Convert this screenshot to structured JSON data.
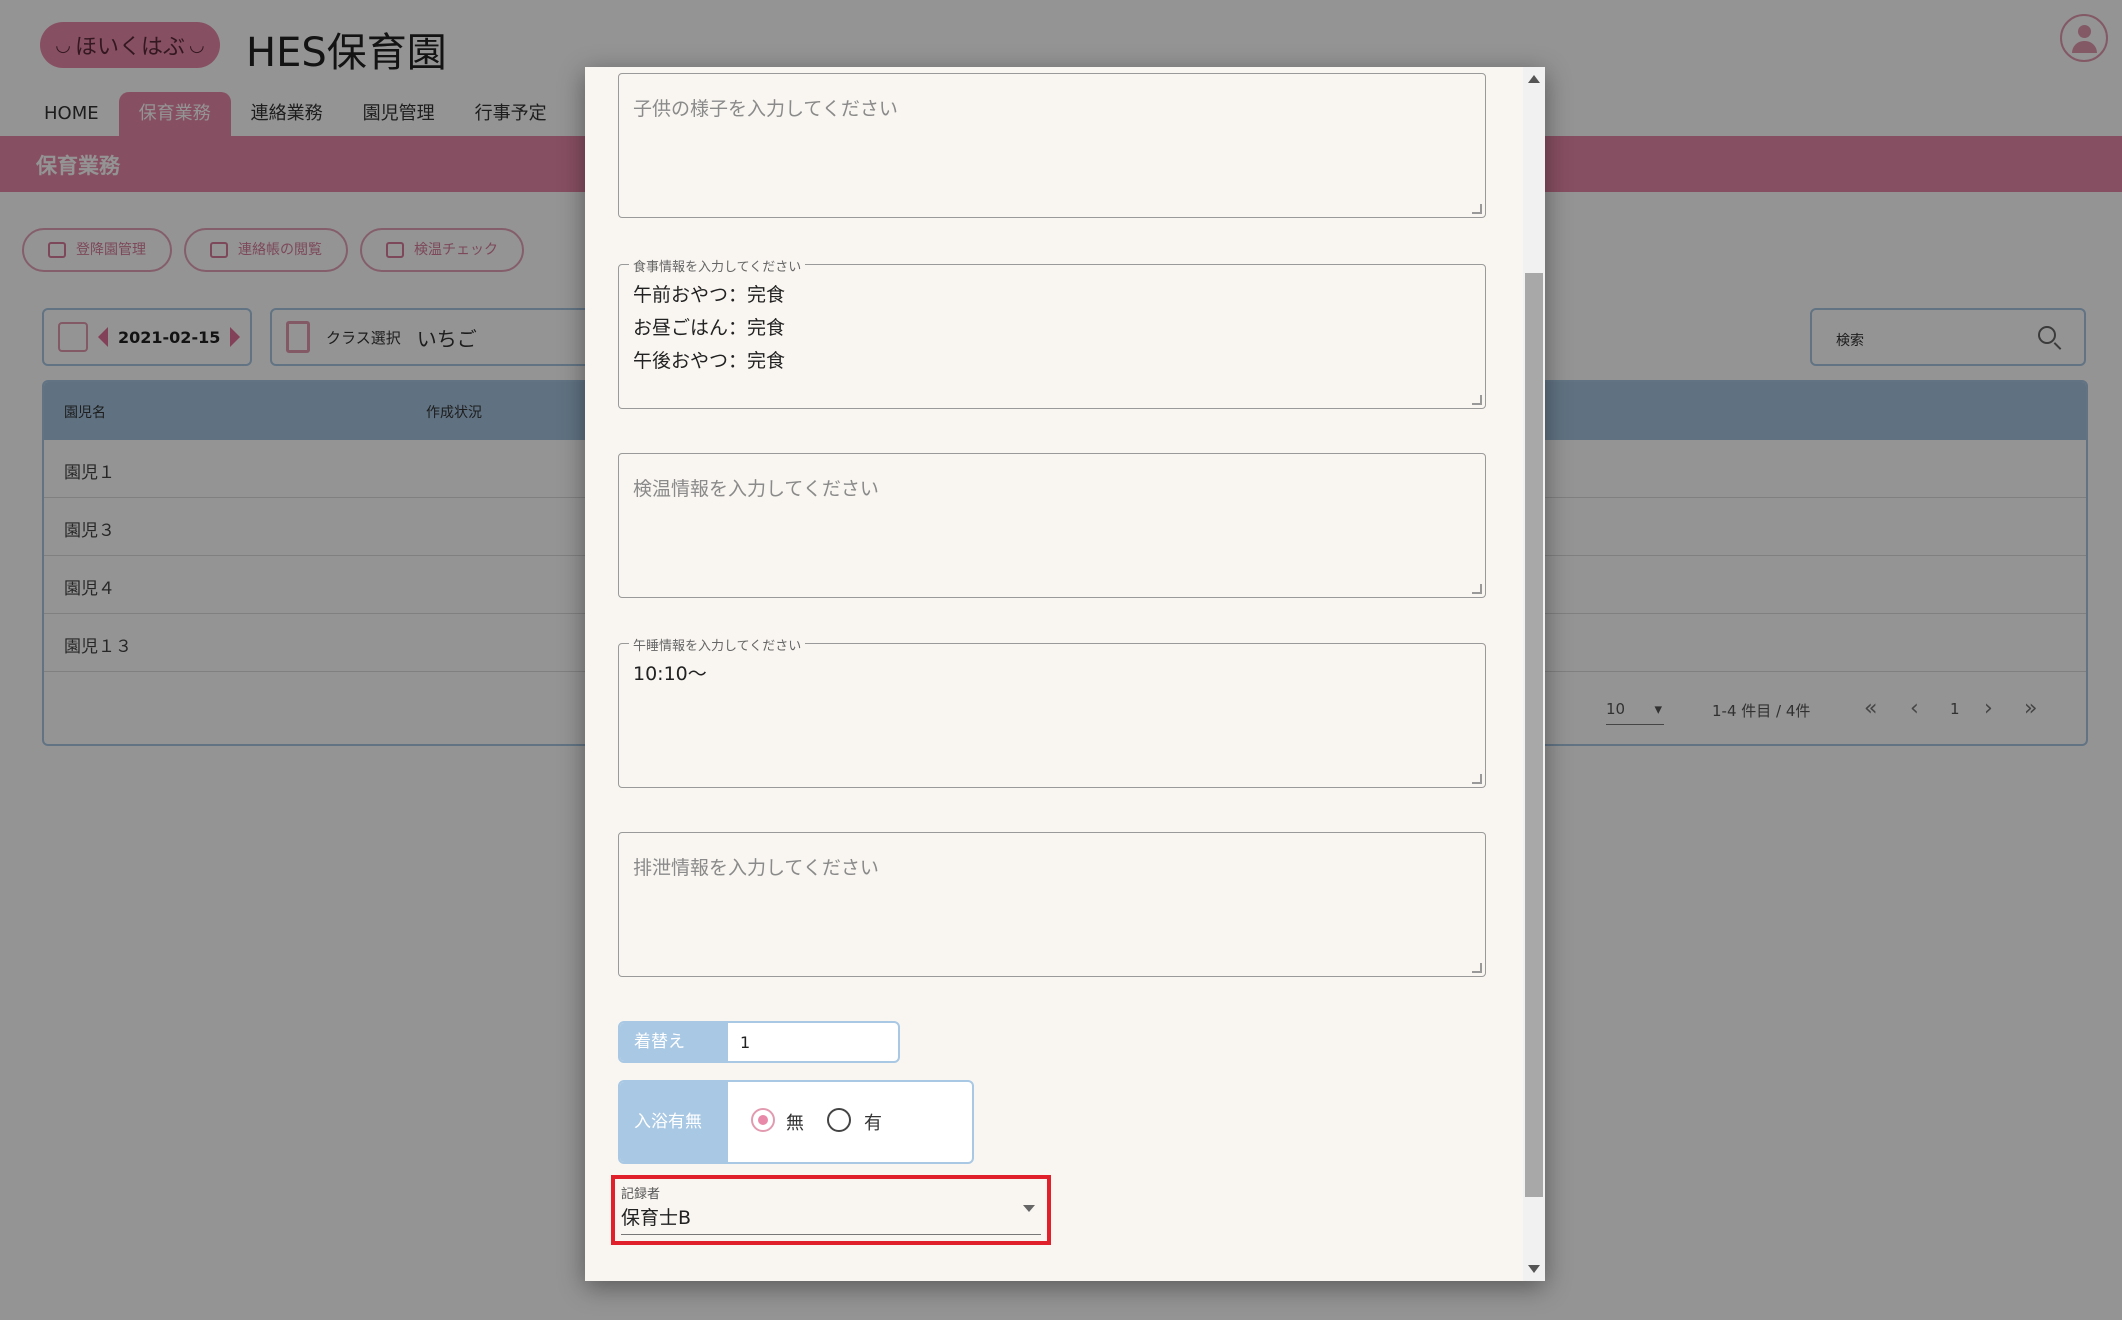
{
  "header": {
    "logo_text": "ほいくはぶ",
    "site_title": "HES保育園"
  },
  "nav": {
    "items": [
      "HOME",
      "保育業務",
      "連絡業務",
      "園児管理",
      "行事予定"
    ]
  },
  "section": {
    "title": "保育業務"
  },
  "tools": {
    "items": [
      "登降園管理",
      "連絡帳の閲覧",
      "検温チェック"
    ]
  },
  "filters": {
    "date": "2021-02-15",
    "class_label": "クラス選択",
    "class_value": "いちご",
    "search_label": "検索"
  },
  "table": {
    "headers": [
      "園児名",
      "作成状況"
    ],
    "rows": [
      "園児１",
      "園児３",
      "園児４",
      "園児１３"
    ],
    "pager": {
      "per_page": "10",
      "range": "1-4 件目 / 4件",
      "page": "1"
    }
  },
  "modal": {
    "child_state_placeholder": "子供の様子を入力してください",
    "meal": {
      "legend": "食事情報を入力してください",
      "value": "午前おやつ：完食\nお昼ごはん：完食\n午後おやつ：完食"
    },
    "temperature_placeholder": "検温情報を入力してください",
    "nap": {
      "legend": "午睡情報を入力してください",
      "value": "10:10～"
    },
    "excretion_placeholder": "排泄情報を入力してください",
    "change": {
      "label": "着替え",
      "value": "1"
    },
    "bath": {
      "label": "入浴有無",
      "options": [
        "無",
        "有"
      ],
      "selected": "無"
    },
    "recorder": {
      "label": "記録者",
      "value": "保育士B"
    }
  },
  "colors": {
    "brand_pink": "#e889a9",
    "accent_blue": "#a9c8e4",
    "highlight_red": "#e0202a"
  }
}
